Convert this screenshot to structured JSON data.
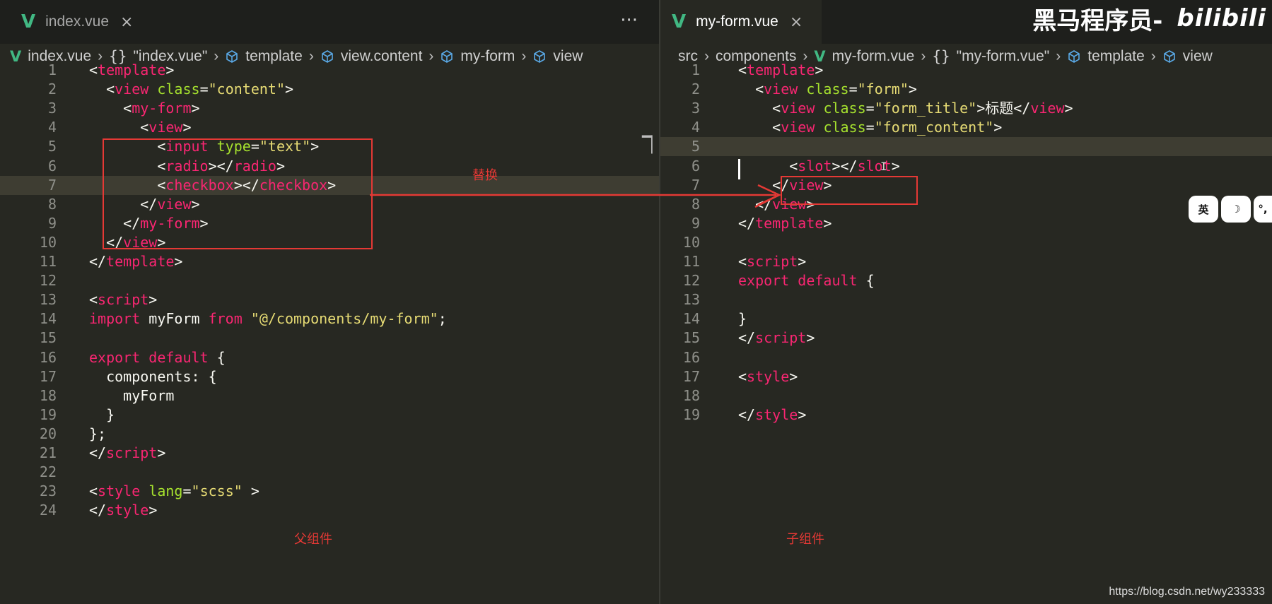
{
  "left": {
    "tab": {
      "icon": "V",
      "label": "index.vue",
      "close": "×"
    },
    "more": "···",
    "breadcrumb": [
      {
        "icon": "vue-icon",
        "glyph": "V",
        "text": "index.vue"
      },
      {
        "icon": "braces-icon",
        "glyph": "{}",
        "text": "\"index.vue\""
      },
      {
        "icon": "cube-icon",
        "glyph": "",
        "text": "template"
      },
      {
        "icon": "cube-icon",
        "glyph": "",
        "text": "view.content"
      },
      {
        "icon": "cube-icon",
        "glyph": "",
        "text": "my-form"
      },
      {
        "icon": "cube-icon",
        "glyph": "",
        "text": "view"
      }
    ],
    "lines": [
      {
        "n": "1",
        "html": [
          [
            "t-pun",
            "<"
          ],
          [
            "t-tag",
            "template"
          ],
          [
            "t-pun",
            ">"
          ]
        ]
      },
      {
        "n": "2",
        "html": [
          [
            "t-pun",
            "  <"
          ],
          [
            "t-tag",
            "view"
          ],
          [
            "t-pun",
            " "
          ],
          [
            "t-attr",
            "class"
          ],
          [
            "t-pun",
            "="
          ],
          [
            "t-str",
            "\"content\""
          ],
          [
            "t-pun",
            ">"
          ]
        ]
      },
      {
        "n": "3",
        "html": [
          [
            "t-pun",
            "    <"
          ],
          [
            "t-tag",
            "my-form"
          ],
          [
            "t-pun",
            ">"
          ]
        ]
      },
      {
        "n": "4",
        "html": [
          [
            "t-pun",
            "      <"
          ],
          [
            "t-tag",
            "view"
          ],
          [
            "t-pun",
            ">"
          ]
        ]
      },
      {
        "n": "5",
        "html": [
          [
            "t-pun",
            "        <"
          ],
          [
            "t-tag",
            "input"
          ],
          [
            "t-pun",
            " "
          ],
          [
            "t-attr",
            "type"
          ],
          [
            "t-pun",
            "="
          ],
          [
            "t-str",
            "\"text\""
          ],
          [
            "t-pun",
            ">"
          ]
        ]
      },
      {
        "n": "6",
        "html": [
          [
            "t-pun",
            "        <"
          ],
          [
            "t-tag",
            "radio"
          ],
          [
            "t-pun",
            "></"
          ],
          [
            "t-tag",
            "radio"
          ],
          [
            "t-pun",
            ">"
          ]
        ]
      },
      {
        "n": "7",
        "html": [
          [
            "t-pun",
            "        <"
          ],
          [
            "t-tag",
            "checkbox"
          ],
          [
            "t-pun",
            "></"
          ],
          [
            "t-tag",
            "checkbox"
          ],
          [
            "t-pun",
            ">"
          ]
        ]
      },
      {
        "n": "8",
        "html": [
          [
            "t-pun",
            "      </"
          ],
          [
            "t-tag",
            "view"
          ],
          [
            "t-pun",
            ">"
          ]
        ]
      },
      {
        "n": "9",
        "html": [
          [
            "t-pun",
            "    </"
          ],
          [
            "t-tag",
            "my-form"
          ],
          [
            "t-pun",
            ">"
          ]
        ]
      },
      {
        "n": "10",
        "html": [
          [
            "t-pun",
            "  </"
          ],
          [
            "t-tag",
            "view"
          ],
          [
            "t-pun",
            ">"
          ]
        ]
      },
      {
        "n": "11",
        "html": [
          [
            "t-pun",
            "</"
          ],
          [
            "t-tag",
            "template"
          ],
          [
            "t-pun",
            ">"
          ]
        ]
      },
      {
        "n": "12",
        "html": []
      },
      {
        "n": "13",
        "html": [
          [
            "t-pun",
            "<"
          ],
          [
            "t-tag",
            "script"
          ],
          [
            "t-pun",
            ">"
          ]
        ]
      },
      {
        "n": "14",
        "html": [
          [
            "t-kw",
            "import"
          ],
          [
            "t-pun",
            " myForm "
          ],
          [
            "t-kw",
            "from"
          ],
          [
            "t-pun",
            " "
          ],
          [
            "t-str",
            "\"@/components/my-form\""
          ],
          [
            "t-pun",
            ";"
          ]
        ]
      },
      {
        "n": "15",
        "html": []
      },
      {
        "n": "16",
        "html": [
          [
            "t-kw",
            "export"
          ],
          [
            "t-pun",
            " "
          ],
          [
            "t-kw",
            "default"
          ],
          [
            "t-pun",
            " {"
          ]
        ]
      },
      {
        "n": "17",
        "html": [
          [
            "t-pun",
            "  components: {"
          ]
        ]
      },
      {
        "n": "18",
        "html": [
          [
            "t-pun",
            "    myForm"
          ]
        ]
      },
      {
        "n": "19",
        "html": [
          [
            "t-pun",
            "  }"
          ]
        ]
      },
      {
        "n": "20",
        "html": [
          [
            "t-pun",
            "};"
          ]
        ]
      },
      {
        "n": "21",
        "html": [
          [
            "t-pun",
            "</"
          ],
          [
            "t-tag",
            "script"
          ],
          [
            "t-pun",
            ">"
          ]
        ]
      },
      {
        "n": "22",
        "html": []
      },
      {
        "n": "23",
        "html": [
          [
            "t-pun",
            "<"
          ],
          [
            "t-tag",
            "style"
          ],
          [
            "t-pun",
            " "
          ],
          [
            "t-attr",
            "lang"
          ],
          [
            "t-pun",
            "="
          ],
          [
            "t-str",
            "\"scss\""
          ],
          [
            "t-pun",
            " >"
          ]
        ]
      },
      {
        "n": "24",
        "html": [
          [
            "t-pun",
            "</"
          ],
          [
            "t-tag",
            "style"
          ],
          [
            "t-pun",
            ">"
          ]
        ]
      }
    ],
    "annotations": {
      "replace": "替换",
      "parent": "父组件"
    }
  },
  "right": {
    "tab": {
      "icon": "V",
      "label": "my-form.vue",
      "close": "×"
    },
    "breadcrumb": [
      {
        "icon": "",
        "glyph": "",
        "text": "src"
      },
      {
        "icon": "",
        "glyph": "",
        "text": "components"
      },
      {
        "icon": "vue-icon",
        "glyph": "V",
        "text": "my-form.vue"
      },
      {
        "icon": "braces-icon",
        "glyph": "{}",
        "text": "\"my-form.vue\""
      },
      {
        "icon": "cube-icon",
        "glyph": "",
        "text": "template"
      },
      {
        "icon": "cube-icon",
        "glyph": "",
        "text": "view"
      }
    ],
    "lines": [
      {
        "n": "1",
        "html": [
          [
            "t-pun",
            "<"
          ],
          [
            "t-tag",
            "template"
          ],
          [
            "t-pun",
            ">"
          ]
        ]
      },
      {
        "n": "2",
        "html": [
          [
            "t-pun",
            "  <"
          ],
          [
            "t-tag",
            "view"
          ],
          [
            "t-pun",
            " "
          ],
          [
            "t-attr",
            "class"
          ],
          [
            "t-pun",
            "="
          ],
          [
            "t-str",
            "\"form\""
          ],
          [
            "t-pun",
            ">"
          ]
        ]
      },
      {
        "n": "3",
        "html": [
          [
            "t-pun",
            "    <"
          ],
          [
            "t-tag",
            "view"
          ],
          [
            "t-pun",
            " "
          ],
          [
            "t-attr",
            "class"
          ],
          [
            "t-pun",
            "="
          ],
          [
            "t-str",
            "\"form_title\""
          ],
          [
            "t-pun",
            ">标题</"
          ],
          [
            "t-tag",
            "view"
          ],
          [
            "t-pun",
            ">"
          ]
        ]
      },
      {
        "n": "4",
        "html": [
          [
            "t-pun",
            "    <"
          ],
          [
            "t-tag",
            "view"
          ],
          [
            "t-pun",
            " "
          ],
          [
            "t-attr",
            "class"
          ],
          [
            "t-pun",
            "="
          ],
          [
            "t-str",
            "\"form_content\""
          ],
          [
            "t-pun",
            ">"
          ]
        ]
      },
      {
        "n": "5",
        "html": []
      },
      {
        "n": "6",
        "html": [
          [
            "t-pun",
            "      <"
          ],
          [
            "t-tag",
            "slot"
          ],
          [
            "t-pun",
            "></"
          ],
          [
            "t-tag",
            "slot"
          ],
          [
            "t-pun",
            ">"
          ]
        ]
      },
      {
        "n": "7",
        "html": [
          [
            "t-pun",
            "    </"
          ],
          [
            "t-tag",
            "view"
          ],
          [
            "t-pun",
            ">"
          ]
        ]
      },
      {
        "n": "8",
        "html": [
          [
            "t-pun",
            "  </"
          ],
          [
            "t-tag",
            "view"
          ],
          [
            "t-pun",
            ">"
          ]
        ]
      },
      {
        "n": "9",
        "html": [
          [
            "t-pun",
            "</"
          ],
          [
            "t-tag",
            "template"
          ],
          [
            "t-pun",
            ">"
          ]
        ]
      },
      {
        "n": "10",
        "html": []
      },
      {
        "n": "11",
        "html": [
          [
            "t-pun",
            "<"
          ],
          [
            "t-tag",
            "script"
          ],
          [
            "t-pun",
            ">"
          ]
        ]
      },
      {
        "n": "12",
        "html": [
          [
            "t-kw",
            "export"
          ],
          [
            "t-pun",
            " "
          ],
          [
            "t-kw",
            "default"
          ],
          [
            "t-pun",
            " {"
          ]
        ]
      },
      {
        "n": "13",
        "html": []
      },
      {
        "n": "14",
        "html": [
          [
            "t-pun",
            "}"
          ]
        ]
      },
      {
        "n": "15",
        "html": [
          [
            "t-pun",
            "</"
          ],
          [
            "t-tag",
            "script"
          ],
          [
            "t-pun",
            ">"
          ]
        ]
      },
      {
        "n": "16",
        "html": []
      },
      {
        "n": "17",
        "html": [
          [
            "t-pun",
            "<"
          ],
          [
            "t-tag",
            "style"
          ],
          [
            "t-pun",
            ">"
          ]
        ]
      },
      {
        "n": "18",
        "html": []
      },
      {
        "n": "19",
        "html": [
          [
            "t-pun",
            "</"
          ],
          [
            "t-tag",
            "style"
          ],
          [
            "t-pun",
            ">"
          ]
        ]
      }
    ],
    "annotations": {
      "child": "子组件"
    }
  },
  "brand": {
    "text": "黑马程序员-",
    "bili": "bilibili"
  },
  "ime": [
    "英",
    "☽",
    "°,"
  ],
  "watermark": "https://blog.csdn.net/wy233333",
  "colors": {
    "tag": "#f92672",
    "attr": "#a6e22e",
    "string": "#e6db74",
    "annotation": "#e53935",
    "vue": "#41b883"
  }
}
